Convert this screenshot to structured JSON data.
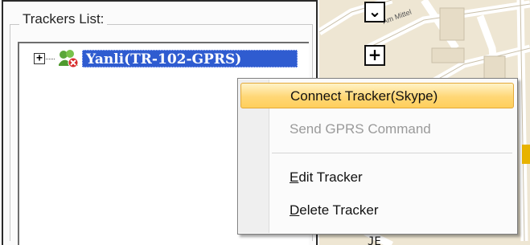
{
  "panel": {
    "title": "Trackers List"
  },
  "tree": {
    "expander_symbol": "+",
    "tracker_label": "Yanli(TR-102-GPRS)",
    "tracker_icon": "tracker-offline-icon"
  },
  "map": {
    "street_label": "Am Mittel",
    "nav_buttons": [
      "arrow-down-icon",
      "plus-icon"
    ]
  },
  "context_menu": {
    "items": [
      {
        "label": "Connect Tracker(Skype)",
        "state": "highlighted"
      },
      {
        "label": "Send GPRS Command",
        "state": "disabled"
      },
      {
        "mnemonic": "E",
        "rest": "dit Tracker",
        "state": "enabled"
      },
      {
        "mnemonic": "D",
        "rest": "elete Tracker",
        "state": "enabled"
      }
    ]
  },
  "colors": {
    "selection": "#2f5cd0",
    "menu_highlight": "#ffd776",
    "map_background": "#eee6d3"
  }
}
